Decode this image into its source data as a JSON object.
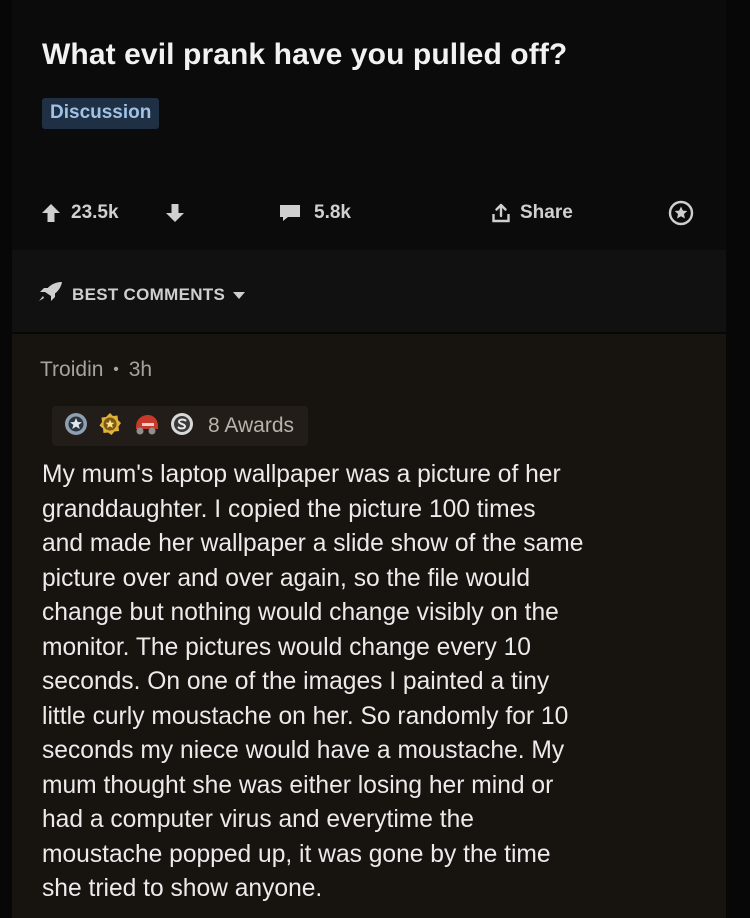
{
  "post": {
    "title": "What evil prank have you pulled off?",
    "flair": "Discussion",
    "votes": "23.5k",
    "comments": "5.8k",
    "share_label": "Share"
  },
  "sort": {
    "label": "BEST COMMENTS"
  },
  "comment": {
    "author": "Troidin",
    "separator": "•",
    "age": "3h",
    "awards_label": "8 Awards",
    "award_icons": [
      "silver-award-icon",
      "gold-award-icon",
      "helmet-award-icon",
      "coin-award-icon"
    ],
    "body_lines": [
      "My mum's laptop wallpaper was a picture of her",
      "granddaughter. I copied the picture 100 times",
      "and made her wallpaper a slide show of the same",
      "picture over and over again, so the file would",
      "change but nothing would change visibly on the",
      "monitor. The pictures would change every 10",
      "seconds. On one of the images I painted a tiny",
      "little curly moustache on her. So randomly for 10",
      "seconds my niece would have a moustache. My",
      "mum thought she was either losing her mind or",
      "had a computer virus and everytime the",
      "moustache popped up, it was gone by the time",
      "she tried to show anyone."
    ]
  },
  "colors": {
    "background": "#070707",
    "comment_bg": "#17130f",
    "flair_bg": "#1f2f44",
    "flair_text": "#9fc2e6"
  }
}
